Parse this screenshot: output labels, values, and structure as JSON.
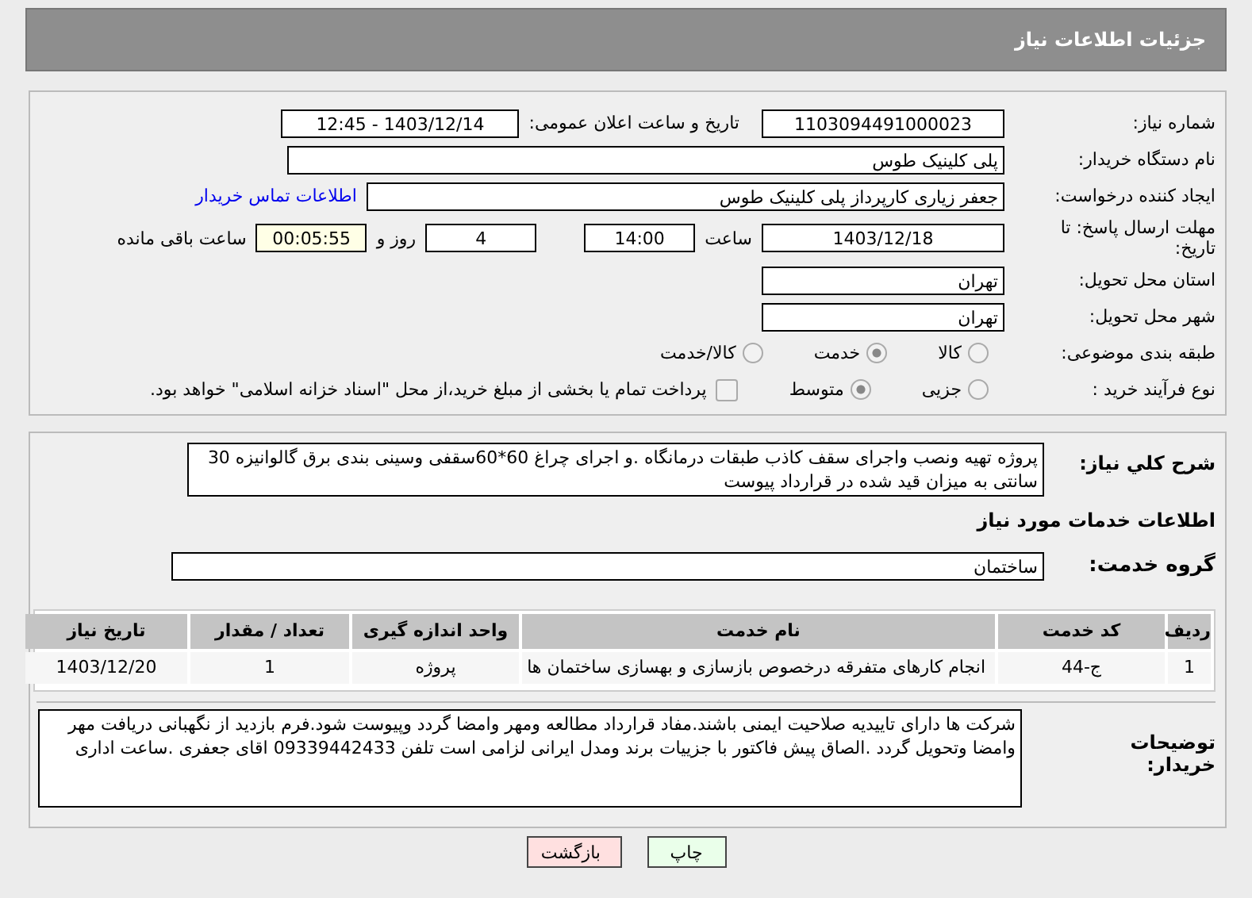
{
  "header": {
    "title": "جزئیات اطلاعات نیاز"
  },
  "need_number": {
    "label": "شماره نیاز:",
    "value": "1103094491000023"
  },
  "announce_date": {
    "label": "تاریخ و ساعت اعلان عمومی:",
    "value": "1403/12/14 - 12:45"
  },
  "buyer_org": {
    "label": "نام دستگاه خریدار:",
    "value": "پلی کلینیک طوس"
  },
  "requester": {
    "label": "ایجاد کننده درخواست:",
    "value": "جعفر زیاری کارپرداز پلی کلینیک طوس",
    "link": "اطلاعات تماس خریدار"
  },
  "deadline": {
    "label": "مهلت ارسال پاسخ: تا تاریخ:",
    "date": "1403/12/18",
    "time_label": "ساعت",
    "time": "14:00",
    "days": "4",
    "days_label": "روز و",
    "remaining": "00:05:55",
    "remaining_label": "ساعت باقی مانده"
  },
  "province": {
    "label": "استان محل تحویل:",
    "value": "تهران"
  },
  "city": {
    "label": "شهر محل تحویل:",
    "value": "تهران"
  },
  "category": {
    "label": "طبقه بندی موضوعی:",
    "options": [
      {
        "label": "کالا",
        "selected": false
      },
      {
        "label": "خدمت",
        "selected": true
      },
      {
        "label": "کالا/خدمت",
        "selected": false
      }
    ]
  },
  "process": {
    "label": "نوع فرآیند خرید :",
    "options": [
      {
        "label": "جزیی",
        "selected": false
      },
      {
        "label": "متوسط",
        "selected": true
      }
    ],
    "payment": {
      "label": "پرداخت تمام یا بخشی از مبلغ خرید،از محل \"اسناد خزانه اسلامی\" خواهد بود.",
      "checked": false
    }
  },
  "description": {
    "label": "شرح کلي نیاز:",
    "value": "پروژه تهیه ونصب واجرای سقف کاذب طبقات درمانگاه .و اجرای چراغ 60*60سقفی وسینی بندی برق گالوانیزه 30 سانتی به میزان قید شده در قرارداد پیوست"
  },
  "services_title": "اطلاعات خدمات مورد نیاز",
  "service_group": {
    "label": "گروه خدمت:",
    "value": "ساختمان"
  },
  "table": {
    "columns": [
      "ردیف",
      "کد خدمت",
      "نام خدمت",
      "واحد اندازه گیری",
      "تعداد / مقدار",
      "تاریخ نیاز"
    ],
    "rows": [
      [
        "1",
        "ج-44",
        "انجام کارهای متفرقه درخصوص بازسازی و بهسازی ساختمان ها",
        "پروژه",
        "1",
        "1403/12/20"
      ]
    ]
  },
  "buyer_notes": {
    "label": "توضیحات خریدار:",
    "value": "شرکت ها دارای تاییدیه صلاحیت ایمنی باشند.مفاد قرارداد مطالعه ومهر وامضا گردد وپیوست شود.فرم بازدید از نگهبانی دریافت مهر وامضا وتحویل گردد .الصاق پیش فاکتور با جزییات برند ومدل ایرانی لزامی است تلفن 09339442433 اقای جعفری .ساعت اداری"
  },
  "buttons": [
    {
      "label": "چاپ",
      "kind": "print"
    },
    {
      "label": "بازگشت",
      "kind": "back"
    }
  ]
}
